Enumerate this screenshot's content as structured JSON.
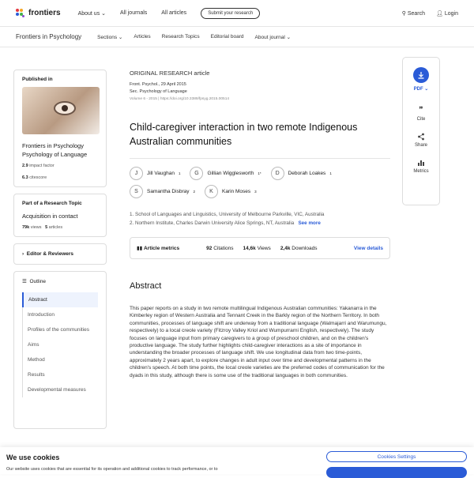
{
  "header": {
    "brand": "frontiers",
    "nav": [
      "About us",
      "All journals",
      "All articles"
    ],
    "submit": "Submit your research",
    "search": "Search",
    "login": "Login"
  },
  "subnav": {
    "journal": "Frontiers in Psychology",
    "items": [
      "Sections",
      "Articles",
      "Research Topics",
      "Editorial board",
      "About journal"
    ]
  },
  "sidebar": {
    "published_in": "Published in",
    "journal": "Frontiers in Psychology",
    "section": "Psychology of Language",
    "impact_value": "2.9",
    "impact_label": "impact factor",
    "citescore_value": "6.3",
    "citescore_label": "citescore",
    "topic_label": "Part of a Research Topic",
    "topic_title": "Acquisition in contact",
    "views_value": "79k",
    "views_label": "views",
    "articles_value": "5",
    "articles_label": "articles",
    "editors": "Editor & Reviewers",
    "outline_title": "Outline",
    "outline": [
      "Abstract",
      "Introduction",
      "Profiles of the communities",
      "Aims",
      "Method",
      "Results",
      "Developmental measures"
    ]
  },
  "article": {
    "type": "ORIGINAL RESEARCH article",
    "journal_date": "Front. Psychol., 29 April 2015",
    "section": "Sec. Psychology of Language",
    "volume": "Volume 6 - 2015 | https://doi.org/10.3389/fpsyg.2015.00514",
    "title": "Child-caregiver interaction in two remote Indigenous Australian communities",
    "authors": [
      {
        "initial": "J",
        "name": "Jill Vaughan",
        "sup": "1"
      },
      {
        "initial": "G",
        "name": "Gillian Wigglesworth",
        "sup": "1*"
      },
      {
        "initial": "D",
        "name": "Deborah Loakes",
        "sup": "1"
      },
      {
        "initial": "S",
        "name": "Samantha Disbray",
        "sup": "2"
      },
      {
        "initial": "K",
        "name": "Karin Moses",
        "sup": "3"
      }
    ],
    "affil1": "1. School of Languages and Linguistics, University of Melbourne Parkville, VIC, Australia",
    "affil2": "2. Northern Institute, Charles Darwin University Alice Springs, NT, Australia",
    "see_more": "See more",
    "metrics_label": "Article metrics",
    "citations_value": "92",
    "citations_label": "Citations",
    "views_value": "14,6k",
    "views_label": "Views",
    "downloads_value": "2,4k",
    "downloads_label": "Downloads",
    "view_details": "View details",
    "abstract_heading": "Abstract",
    "abstract": "This paper reports on a study in two remote multilingual Indigenous Australian communities: Yakanarra in the Kimberley region of Western Australia and Tennant Creek in the Barkly region of the Northern Territory. In both communities, processes of language shift are underway from a traditional language (Walmajarri and Warumungu, respectively) to a local creole variety (Fitzroy Valley Kriol and Wumpurrarni English, respectively). The study focuses on language input from primary caregivers to a group of preschool children, and on the children's productive language. The study further highlights child-caregiver interactions as a site of importance in understanding the broader processes of language shift. We use longitudinal data from two time-points, approximately 2 years apart, to explore changes in adult input over time and developmental patterns in the children's speech. At both time points, the local creole varieties are the preferred codes of communication for the dyads in this study, although there is some use of the traditional languages in both communities."
  },
  "rail": {
    "pdf": "PDF",
    "cite": "Cite",
    "share": "Share",
    "metrics": "Metrics"
  },
  "cookie": {
    "title": "We use cookies",
    "text": "Our website uses cookies that are essential for its operation and additional cookies to track performance, or to",
    "settings": "Cookies Settings"
  },
  "colors": {
    "accent": "#2a5bd7"
  }
}
